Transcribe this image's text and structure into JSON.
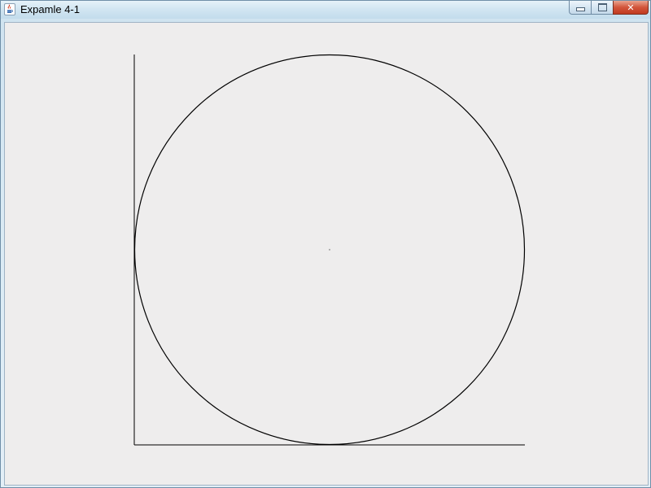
{
  "window": {
    "title": "Expamle 4-1",
    "title_icon": "java-coffee-cup-icon"
  },
  "caption_buttons": {
    "minimize_icon": "minimize-icon",
    "maximize_icon": "maximize-icon",
    "close_icon": "close-icon",
    "close_glyph": "✕",
    "close_color": "#c13a20"
  },
  "canvas": {
    "background": "#eeeded",
    "stroke_color": "#000000"
  }
}
